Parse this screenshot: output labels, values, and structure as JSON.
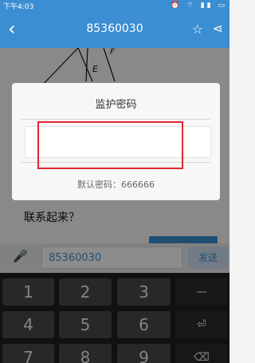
{
  "status_bar": {
    "time": "下午4:03",
    "icons": "⏰ ⌔ ▮▮ ▭"
  },
  "header": {
    "back_icon": "‹",
    "title": "85360030",
    "star_icon": "☆",
    "share_icon": "⋖"
  },
  "content": {
    "diagram_labels": [
      "F",
      "E"
    ],
    "question_text": "联系起来？"
  },
  "dialog": {
    "title": "监护密码",
    "password_placeholder": "",
    "hint": "默认密码：666666"
  },
  "input_bar": {
    "mic_icon": "🎤",
    "value": "85360030",
    "send_label": "发送"
  },
  "keyboard": {
    "row1": [
      "1",
      "2",
      "3",
      "—"
    ],
    "row2": [
      "4",
      "5",
      "6",
      "⏎"
    ],
    "row3": [
      "7",
      "8",
      "9",
      "⌫"
    ]
  },
  "colors": {
    "accent": "#3b8ed2",
    "highlight": "#e0262c"
  }
}
